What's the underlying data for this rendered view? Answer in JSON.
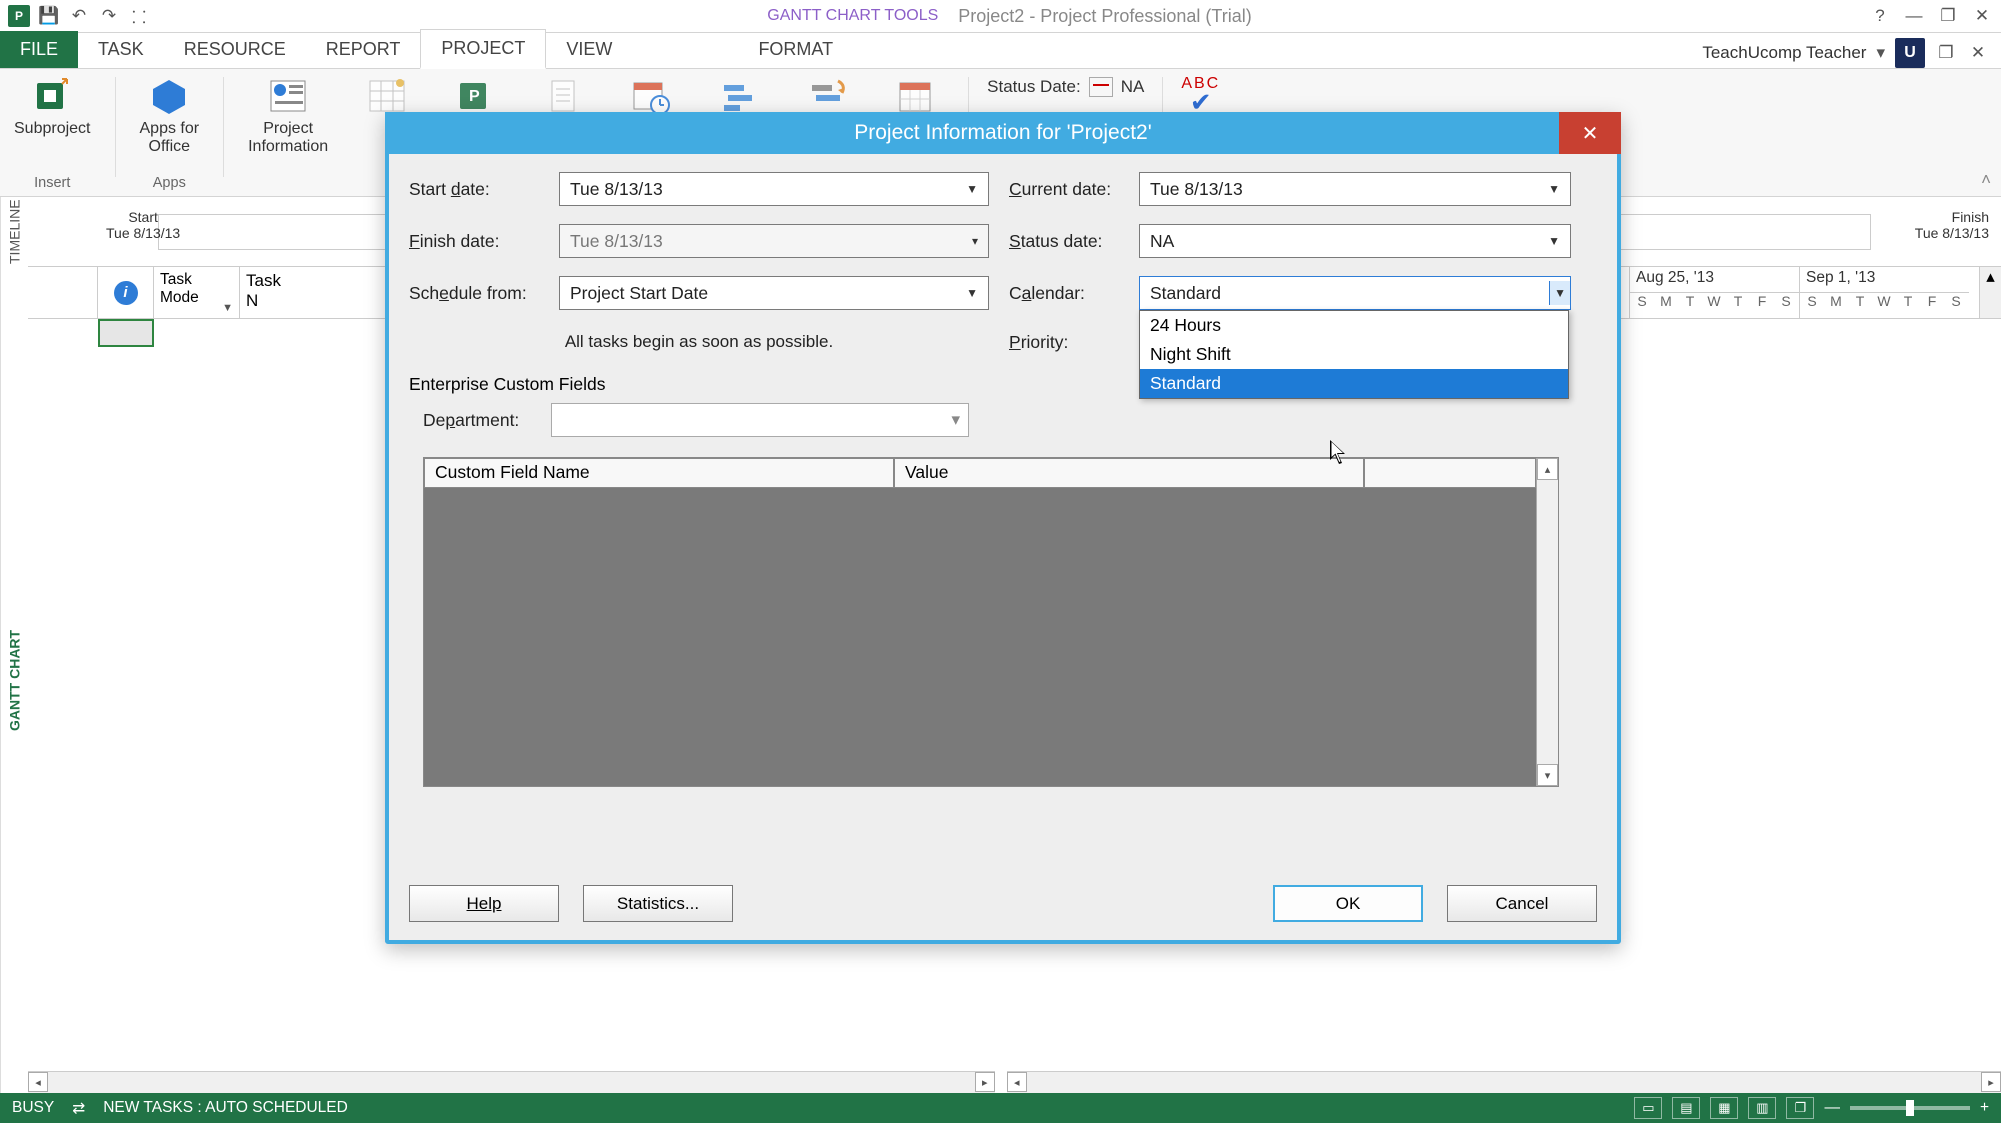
{
  "titlebar": {
    "contextual_label": "GANTT CHART TOOLS",
    "doc_title": "Project2 - Project Professional (Trial)"
  },
  "user": {
    "name": "TeachUcomp Teacher",
    "avatar_letter": "U"
  },
  "tabs": {
    "file": "FILE",
    "task": "TASK",
    "resource": "RESOURCE",
    "report": "REPORT",
    "project": "PROJECT",
    "view": "VIEW",
    "format": "FORMAT"
  },
  "ribbon": {
    "subproject": "Subproject",
    "apps_for_office": "Apps for\nOffice",
    "project_information": "Project\nInformation",
    "insert_group": "Insert",
    "apps_group": "Apps",
    "status_date_label": "Status Date:",
    "status_date_value": "NA",
    "abc": "ABC"
  },
  "sheet": {
    "timeline_side": "TIMELINE",
    "gantt_side": "GANTT CHART",
    "start_label": "Start",
    "start_date": "Tue 8/13/13",
    "finish_label": "Finish",
    "finish_date": "Tue 8/13/13",
    "task_mode_header": "Task\nMode",
    "task_name_header": "Task N",
    "date_groups": [
      "Aug 25, '13",
      "Sep 1, '13"
    ],
    "day_letters": [
      "S",
      "M",
      "T",
      "W",
      "T",
      "F",
      "S"
    ]
  },
  "dialog": {
    "title": "Project Information for 'Project2'",
    "start_date_label": "Start date:",
    "start_date_value": "Tue 8/13/13",
    "finish_date_label": "Finish date:",
    "finish_date_value": "Tue 8/13/13",
    "schedule_from_label": "Schedule from:",
    "schedule_from_value": "Project Start Date",
    "hint": "All tasks begin as soon as possible.",
    "current_date_label": "Current date:",
    "current_date_value": "Tue 8/13/13",
    "status_date_label": "Status date:",
    "status_date_value": "NA",
    "calendar_label": "Calendar:",
    "calendar_value": "Standard",
    "calendar_options": [
      "24 Hours",
      "Night Shift",
      "Standard"
    ],
    "calendar_selected_index": 2,
    "priority_label": "Priority:",
    "ecf_label": "Enterprise Custom Fields",
    "department_label": "Department:",
    "cf_name_header": "Custom Field Name",
    "cf_value_header": "Value",
    "help_btn": "Help",
    "statistics_btn": "Statistics...",
    "ok_btn": "OK",
    "cancel_btn": "Cancel"
  },
  "statusbar": {
    "state": "BUSY",
    "new_tasks": "NEW TASKS : AUTO SCHEDULED"
  }
}
